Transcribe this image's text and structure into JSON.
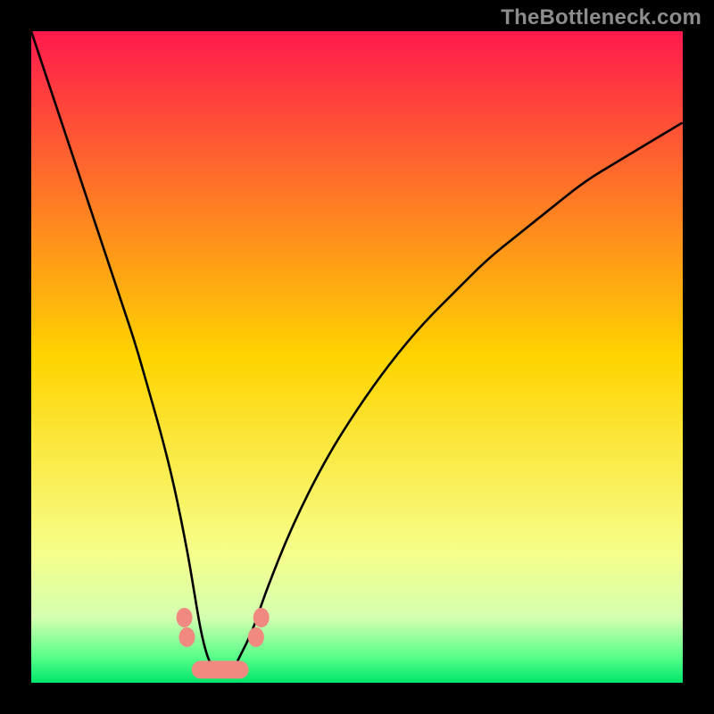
{
  "watermark": "TheBottleneck.com",
  "chart_data": {
    "type": "line",
    "title": "",
    "xlabel": "",
    "ylabel": "",
    "xlim": [
      0,
      100
    ],
    "ylim": [
      0,
      100
    ],
    "grid": false,
    "legend": false,
    "background_gradient": {
      "stops": [
        {
          "pos": 0.0,
          "color": "#ff1a4d"
        },
        {
          "pos": 0.5,
          "color": "#ffd400"
        },
        {
          "pos": 0.8,
          "color": "#f6ff8a"
        },
        {
          "pos": 0.9,
          "color": "#d4ffb0"
        },
        {
          "pos": 0.96,
          "color": "#5aff8a"
        },
        {
          "pos": 1.0,
          "color": "#00e56a"
        }
      ]
    },
    "series": [
      {
        "name": "bottleneck-curve",
        "stroke": "#000000",
        "x": [
          0,
          2,
          4,
          6,
          8,
          10,
          12,
          14,
          16,
          18,
          20,
          22,
          24,
          25,
          26,
          27,
          28,
          29,
          30,
          31,
          32,
          34,
          36,
          40,
          45,
          50,
          55,
          60,
          65,
          70,
          75,
          80,
          85,
          90,
          95,
          100
        ],
        "y": [
          100,
          94,
          88,
          82,
          76,
          70,
          64,
          58,
          52,
          45,
          38,
          30,
          20,
          14,
          8,
          4,
          2,
          1,
          1,
          2,
          4,
          8,
          14,
          24,
          34,
          42,
          49,
          55,
          60,
          65,
          69,
          73,
          77,
          80,
          83,
          86
        ]
      },
      {
        "name": "markers-left",
        "stroke": "#f08a80",
        "shape": "blob",
        "points": [
          {
            "x": 23.5,
            "y": 10
          },
          {
            "x": 23.9,
            "y": 7
          }
        ]
      },
      {
        "name": "markers-bottom",
        "stroke": "#f08a80",
        "shape": "blob-wide",
        "points": [
          {
            "x": 26,
            "y": 2
          },
          {
            "x": 28,
            "y": 1
          },
          {
            "x": 30,
            "y": 1
          },
          {
            "x": 32,
            "y": 2
          }
        ]
      },
      {
        "name": "markers-right",
        "stroke": "#f08a80",
        "shape": "blob",
        "points": [
          {
            "x": 34.5,
            "y": 7
          },
          {
            "x": 35.3,
            "y": 10
          }
        ]
      }
    ]
  }
}
